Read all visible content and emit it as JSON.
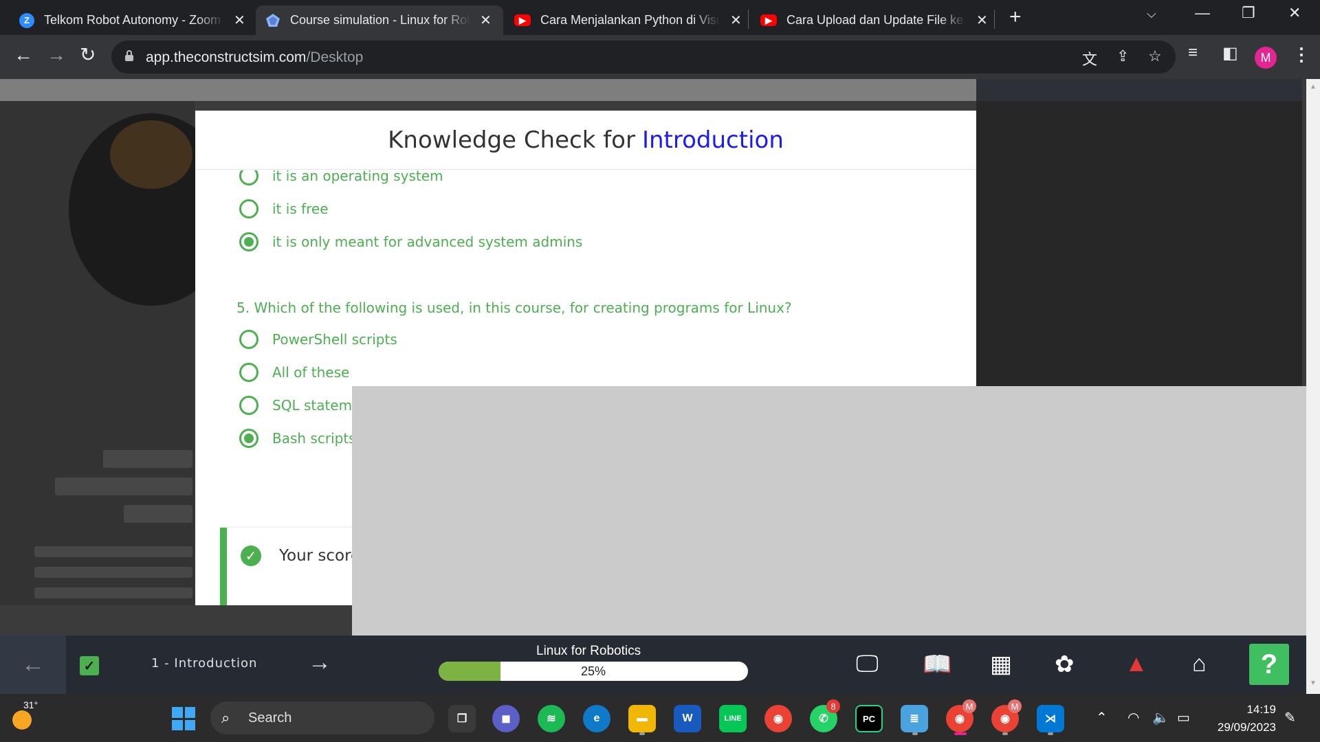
{
  "browser": {
    "tabs": [
      {
        "label": "Telkom Robot Autonomy - Zoom",
        "favicon": "zoom-icon",
        "active": false
      },
      {
        "label": "Course simulation - Linux for Robotics",
        "favicon": "theconstruct-icon",
        "active": true
      },
      {
        "label": "Cara Menjalankan Python di Visual Studio Code",
        "favicon": "youtube-icon",
        "active": false
      },
      {
        "label": "Cara Upload dan Update File ke GitHub",
        "favicon": "youtube-icon",
        "active": false
      }
    ],
    "close_glyph": "✕",
    "new_tab_glyph": "+",
    "url_host": "app.theconstructsim.com",
    "url_path": "/Desktop",
    "profile_initial": "M"
  },
  "quiz": {
    "title_prefix": "Knowledge Check for",
    "title_accent": "Introduction",
    "accent_color": "#1a1aff",
    "answer_color": "#4caf50",
    "prev_options": [
      {
        "label": "it is an operating system",
        "selected": false
      },
      {
        "label": "it is free",
        "selected": false
      },
      {
        "label": "it is only meant for advanced system admins",
        "selected": true
      }
    ],
    "question5": "5. Which of the following is used, in this course, for creating programs for Linux?",
    "q5_options": [
      {
        "label": "PowerShell scripts",
        "selected": false
      },
      {
        "label": "All of these",
        "selected": false
      },
      {
        "label": "SQL stateme",
        "selected": false
      },
      {
        "label": "Bash scripts",
        "selected": true
      }
    ],
    "score_text": "Your score"
  },
  "course_bar": {
    "chapter": "1 - Introduction",
    "course_title": "Linux for Robotics",
    "progress_label": "25%",
    "progress_value": 0.25,
    "progress_color": "#7cb342",
    "help_label": "?"
  },
  "taskbar": {
    "temperature": "31°",
    "search_label": "Search",
    "whatsapp_badge": "8",
    "chrome_badge_1": "M",
    "chrome_badge_2": "M",
    "time": "14:19",
    "date": "29/09/2023"
  }
}
